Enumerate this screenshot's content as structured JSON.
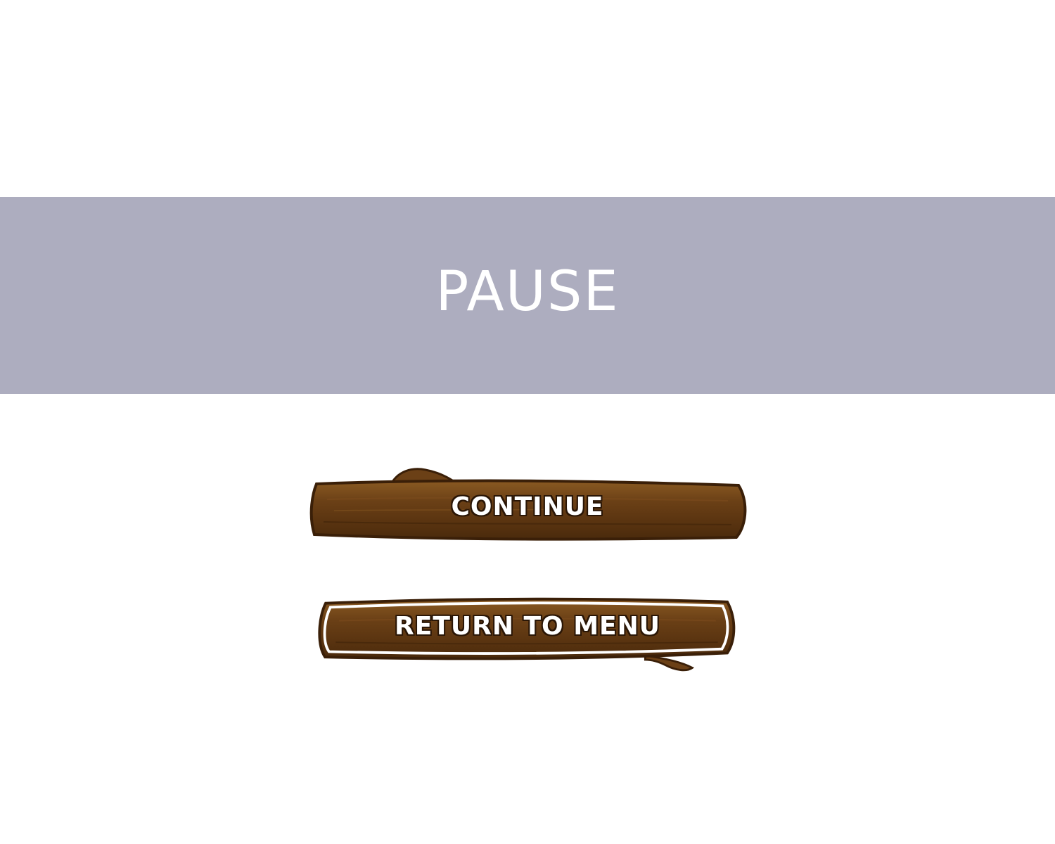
{
  "pause_screen": {
    "title": "PAUSE",
    "buttons": [
      {
        "label": "CONTINUE"
      },
      {
        "label": "RETURN TO MENU"
      }
    ]
  },
  "colors": {
    "banner": "#adadbf",
    "background": "#ffffff",
    "wood_dark": "#4a2a0c",
    "wood_mid": "#6b4016",
    "wood_light": "#8a5a22",
    "text": "#ffffff"
  }
}
